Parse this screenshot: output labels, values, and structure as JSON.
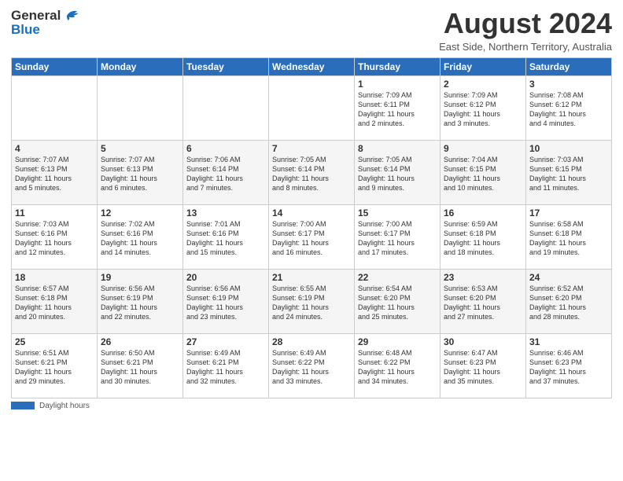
{
  "header": {
    "logo_general": "General",
    "logo_blue": "Blue",
    "month_title": "August 2024",
    "subtitle": "East Side, Northern Territory, Australia"
  },
  "weekdays": [
    "Sunday",
    "Monday",
    "Tuesday",
    "Wednesday",
    "Thursday",
    "Friday",
    "Saturday"
  ],
  "weeks": [
    [
      {
        "day": "",
        "info": ""
      },
      {
        "day": "",
        "info": ""
      },
      {
        "day": "",
        "info": ""
      },
      {
        "day": "",
        "info": ""
      },
      {
        "day": "1",
        "info": "Sunrise: 7:09 AM\nSunset: 6:11 PM\nDaylight: 11 hours\nand 2 minutes."
      },
      {
        "day": "2",
        "info": "Sunrise: 7:09 AM\nSunset: 6:12 PM\nDaylight: 11 hours\nand 3 minutes."
      },
      {
        "day": "3",
        "info": "Sunrise: 7:08 AM\nSunset: 6:12 PM\nDaylight: 11 hours\nand 4 minutes."
      }
    ],
    [
      {
        "day": "4",
        "info": "Sunrise: 7:07 AM\nSunset: 6:13 PM\nDaylight: 11 hours\nand 5 minutes."
      },
      {
        "day": "5",
        "info": "Sunrise: 7:07 AM\nSunset: 6:13 PM\nDaylight: 11 hours\nand 6 minutes."
      },
      {
        "day": "6",
        "info": "Sunrise: 7:06 AM\nSunset: 6:14 PM\nDaylight: 11 hours\nand 7 minutes."
      },
      {
        "day": "7",
        "info": "Sunrise: 7:05 AM\nSunset: 6:14 PM\nDaylight: 11 hours\nand 8 minutes."
      },
      {
        "day": "8",
        "info": "Sunrise: 7:05 AM\nSunset: 6:14 PM\nDaylight: 11 hours\nand 9 minutes."
      },
      {
        "day": "9",
        "info": "Sunrise: 7:04 AM\nSunset: 6:15 PM\nDaylight: 11 hours\nand 10 minutes."
      },
      {
        "day": "10",
        "info": "Sunrise: 7:03 AM\nSunset: 6:15 PM\nDaylight: 11 hours\nand 11 minutes."
      }
    ],
    [
      {
        "day": "11",
        "info": "Sunrise: 7:03 AM\nSunset: 6:16 PM\nDaylight: 11 hours\nand 12 minutes."
      },
      {
        "day": "12",
        "info": "Sunrise: 7:02 AM\nSunset: 6:16 PM\nDaylight: 11 hours\nand 14 minutes."
      },
      {
        "day": "13",
        "info": "Sunrise: 7:01 AM\nSunset: 6:16 PM\nDaylight: 11 hours\nand 15 minutes."
      },
      {
        "day": "14",
        "info": "Sunrise: 7:00 AM\nSunset: 6:17 PM\nDaylight: 11 hours\nand 16 minutes."
      },
      {
        "day": "15",
        "info": "Sunrise: 7:00 AM\nSunset: 6:17 PM\nDaylight: 11 hours\nand 17 minutes."
      },
      {
        "day": "16",
        "info": "Sunrise: 6:59 AM\nSunset: 6:18 PM\nDaylight: 11 hours\nand 18 minutes."
      },
      {
        "day": "17",
        "info": "Sunrise: 6:58 AM\nSunset: 6:18 PM\nDaylight: 11 hours\nand 19 minutes."
      }
    ],
    [
      {
        "day": "18",
        "info": "Sunrise: 6:57 AM\nSunset: 6:18 PM\nDaylight: 11 hours\nand 20 minutes."
      },
      {
        "day": "19",
        "info": "Sunrise: 6:56 AM\nSunset: 6:19 PM\nDaylight: 11 hours\nand 22 minutes."
      },
      {
        "day": "20",
        "info": "Sunrise: 6:56 AM\nSunset: 6:19 PM\nDaylight: 11 hours\nand 23 minutes."
      },
      {
        "day": "21",
        "info": "Sunrise: 6:55 AM\nSunset: 6:19 PM\nDaylight: 11 hours\nand 24 minutes."
      },
      {
        "day": "22",
        "info": "Sunrise: 6:54 AM\nSunset: 6:20 PM\nDaylight: 11 hours\nand 25 minutes."
      },
      {
        "day": "23",
        "info": "Sunrise: 6:53 AM\nSunset: 6:20 PM\nDaylight: 11 hours\nand 27 minutes."
      },
      {
        "day": "24",
        "info": "Sunrise: 6:52 AM\nSunset: 6:20 PM\nDaylight: 11 hours\nand 28 minutes."
      }
    ],
    [
      {
        "day": "25",
        "info": "Sunrise: 6:51 AM\nSunset: 6:21 PM\nDaylight: 11 hours\nand 29 minutes."
      },
      {
        "day": "26",
        "info": "Sunrise: 6:50 AM\nSunset: 6:21 PM\nDaylight: 11 hours\nand 30 minutes."
      },
      {
        "day": "27",
        "info": "Sunrise: 6:49 AM\nSunset: 6:21 PM\nDaylight: 11 hours\nand 32 minutes."
      },
      {
        "day": "28",
        "info": "Sunrise: 6:49 AM\nSunset: 6:22 PM\nDaylight: 11 hours\nand 33 minutes."
      },
      {
        "day": "29",
        "info": "Sunrise: 6:48 AM\nSunset: 6:22 PM\nDaylight: 11 hours\nand 34 minutes."
      },
      {
        "day": "30",
        "info": "Sunrise: 6:47 AM\nSunset: 6:23 PM\nDaylight: 11 hours\nand 35 minutes."
      },
      {
        "day": "31",
        "info": "Sunrise: 6:46 AM\nSunset: 6:23 PM\nDaylight: 11 hours\nand 37 minutes."
      }
    ]
  ],
  "footer": {
    "daylight_label": "Daylight hours"
  }
}
